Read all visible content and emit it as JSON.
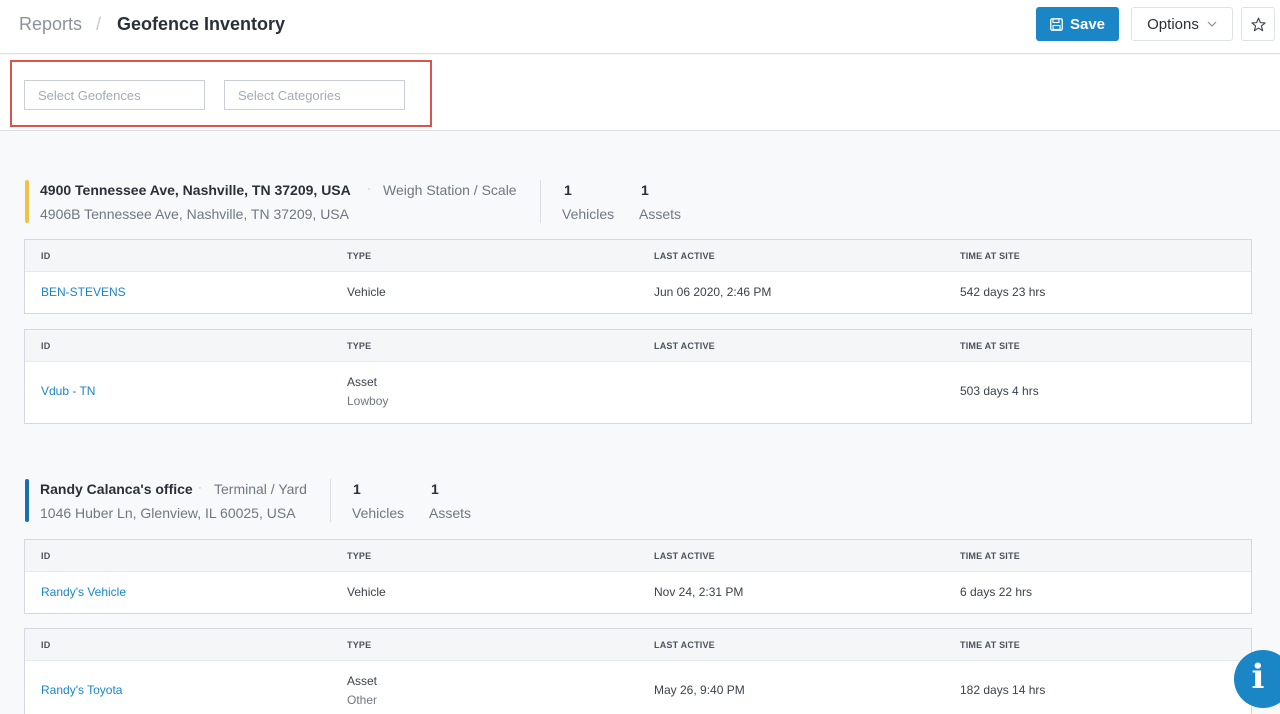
{
  "breadcrumb": {
    "root": "Reports",
    "separator": "/",
    "current": "Geofence Inventory"
  },
  "header": {
    "save_label": "Save",
    "options_label": "Options"
  },
  "filters": {
    "geofences_placeholder": "Select Geofences",
    "categories_placeholder": "Select Categories"
  },
  "columns": {
    "id": "ID",
    "type": "TYPE",
    "last_active": "LAST ACTIVE",
    "time_at_site": "TIME AT SITE"
  },
  "colors": {
    "accent": "#1a86c6",
    "highlight": "#d9534f",
    "geofence1_bar": "#f0c24a",
    "geofence2_bar": "#1a6eb0"
  },
  "geofences": [
    {
      "name": "4900 Tennessee Ave, Nashville, TN 37209, USA",
      "dot": "·",
      "category": "Weigh Station / Scale",
      "address": "4906B Tennessee Ave, Nashville, TN 37209, USA",
      "vehicles_count": "1",
      "vehicles_label": "Vehicles",
      "assets_count": "1",
      "assets_label": "Assets",
      "vehicle": {
        "id": "BEN-STEVENS",
        "type": "Vehicle",
        "last_active": "Jun 06 2020, 2:46 PM",
        "time_at_site": "542 days 23 hrs"
      },
      "asset": {
        "id": "Vdub - TN",
        "type": "Asset",
        "subtype": "Lowboy",
        "last_active": "",
        "time_at_site": "503 days 4 hrs"
      }
    },
    {
      "name": "Randy Calanca's office",
      "dot": "·",
      "category": "Terminal / Yard",
      "address": "1046 Huber Ln, Glenview, IL 60025, USA",
      "vehicles_count": "1",
      "vehicles_label": "Vehicles",
      "assets_count": "1",
      "assets_label": "Assets",
      "vehicle": {
        "id": "Randy's Vehicle",
        "type": "Vehicle",
        "last_active": "Nov 24, 2:31 PM",
        "time_at_site": "6 days 22 hrs"
      },
      "asset": {
        "id": "Randy's Toyota",
        "type": "Asset",
        "subtype": "Other",
        "last_active": "May 26, 9:40 PM",
        "time_at_site": "182 days 14 hrs"
      }
    }
  ],
  "info_fab": {
    "icon": "info-icon",
    "glyph": "i"
  }
}
